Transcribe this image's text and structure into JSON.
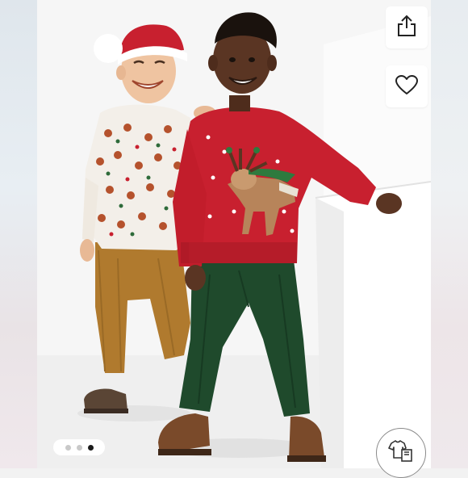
{
  "listing": {
    "photo_subject": "",
    "carousel": {
      "total": 3,
      "active_index": 2
    }
  },
  "actions": {
    "share_icon": "share-icon",
    "like_icon": "heart-icon",
    "similar_icon": "clothing-icon"
  },
  "colors": {
    "sweater_red": "#c8202f",
    "pants_green": "#1f4a2c",
    "pants_tan": "#b07a2e",
    "background": "#f7f7f7"
  }
}
